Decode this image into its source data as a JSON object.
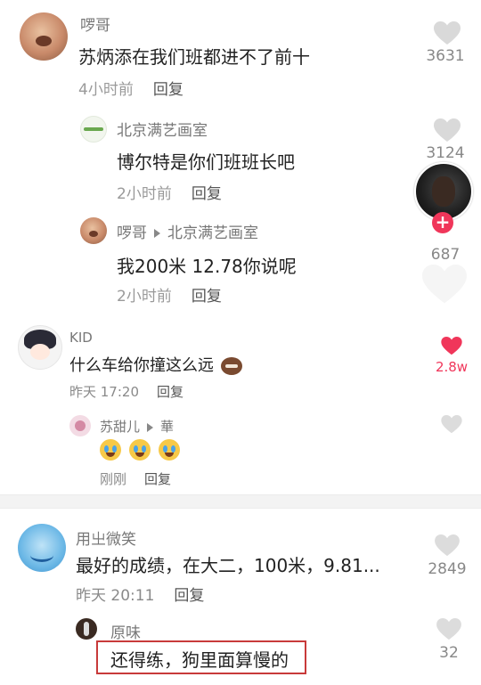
{
  "comments": [
    {
      "user": "啰哥",
      "text": "苏炳添在我们班都进不了前十",
      "time": "4小时前",
      "reply_label": "回复",
      "likes": "3631"
    },
    {
      "user": "北京满艺画室",
      "text": "博尔特是你们班班长吧",
      "time": "2小时前",
      "reply_label": "回复",
      "likes": "3124"
    },
    {
      "user": "啰哥",
      "reply_to": "北京满艺画室",
      "text": "我200米 12.78你说呢",
      "time": "2小时前",
      "reply_label": "回复",
      "likes": "687"
    },
    {
      "user": "KID",
      "text": "什么车给你撞这么远",
      "time": "昨天 17:20",
      "reply_label": "回复",
      "likes": "2.8w"
    },
    {
      "user": "苏甜儿",
      "reply_to": "華",
      "time": "刚刚",
      "reply_label": "回复"
    },
    {
      "user": "用㞢微笑",
      "text": "最好的成绩，在大二，100米，9.81...",
      "time": "昨天 20:11",
      "reply_label": "回复",
      "likes": "2849"
    },
    {
      "user": "原味",
      "text": "还得练，狗里面算慢的",
      "likes": "32"
    }
  ],
  "colors": {
    "liked_heart": "#f0365a",
    "follow_badge": "#f0365a",
    "highlight_box": "#c83a3a"
  }
}
